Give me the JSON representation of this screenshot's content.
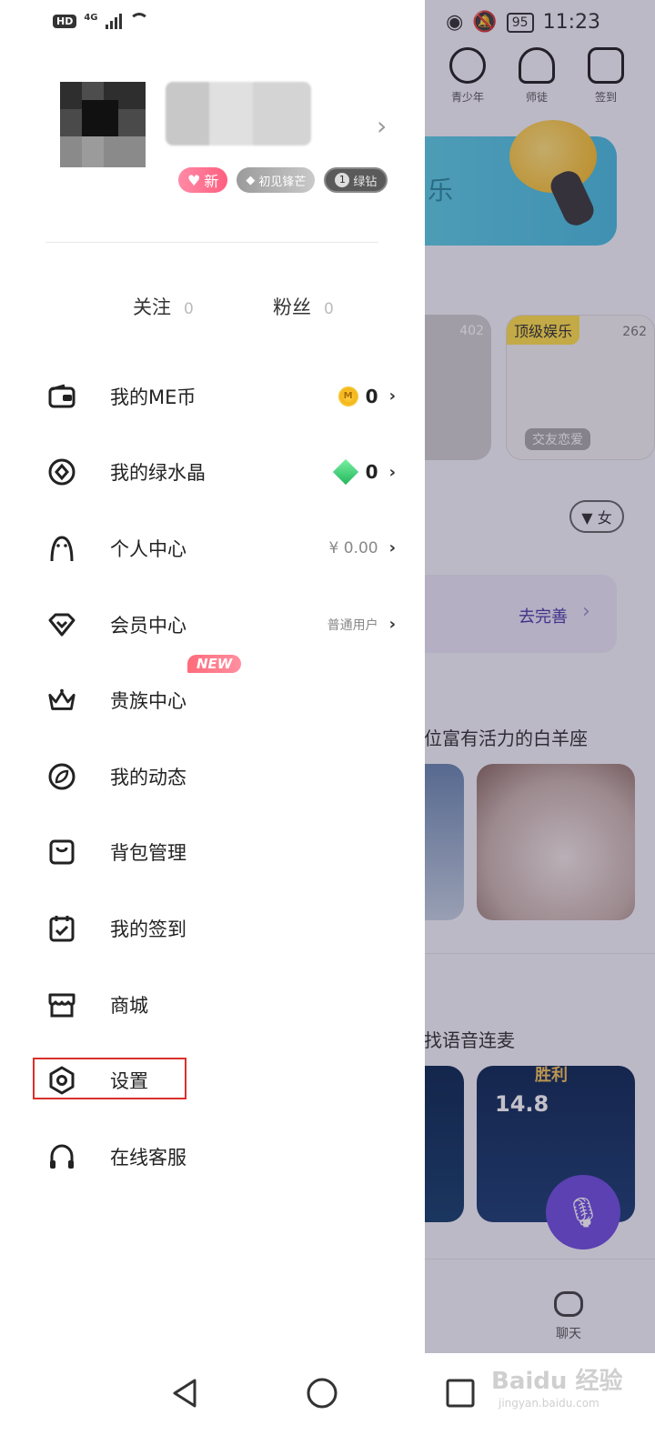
{
  "background": {
    "status_time": "11:23",
    "battery": "95",
    "top_icons": [
      {
        "label": "青少年",
        "icon": "teen-icon"
      },
      {
        "label": "师徒",
        "icon": "mentor-icon"
      },
      {
        "label": "签到",
        "icon": "checkin-icon"
      }
    ],
    "banner_text": "乐",
    "cards": [
      {
        "count": "402"
      },
      {
        "tag": "顶级娱乐",
        "count": "262",
        "subtitle": "交友恋爱"
      }
    ],
    "filter_label": "▼ 女",
    "complete_label": "去完善",
    "section_1": "位富有活力的白羊座",
    "section_2": "找语音连麦",
    "game_score": "14.8",
    "game_win": "胜利",
    "chat_label": "聊天"
  },
  "status_bar": {
    "hd": "HD",
    "network": "4G"
  },
  "profile": {
    "badges": [
      {
        "label": "新",
        "type": "new"
      },
      {
        "label": "初见锋芒",
        "type": "rank"
      },
      {
        "label": "绿钻",
        "level": "1",
        "type": "green"
      }
    ]
  },
  "follow": {
    "following_label": "关注",
    "following_count": "0",
    "fans_label": "粉丝",
    "fans_count": "0"
  },
  "menu": [
    {
      "label": "我的ME币",
      "icon": "wallet-icon",
      "value": "0"
    },
    {
      "label": "我的绿水晶",
      "icon": "crystal-icon",
      "value": "0"
    },
    {
      "label": "个人中心",
      "icon": "person-icon",
      "value": "¥ 0.00"
    },
    {
      "label": "会员中心",
      "icon": "diamond-icon",
      "value": "普通用户"
    },
    {
      "label": "贵族中心",
      "icon": "crown-icon",
      "tag": "NEW"
    },
    {
      "label": "我的动态",
      "icon": "leaf-icon"
    },
    {
      "label": "背包管理",
      "icon": "bag-icon"
    },
    {
      "label": "我的签到",
      "icon": "calendar-check-icon"
    },
    {
      "label": "商城",
      "icon": "store-icon"
    },
    {
      "label": "设置",
      "icon": "settings-hex-icon"
    },
    {
      "label": "在线客服",
      "icon": "headset-icon"
    }
  ],
  "watermark": {
    "logo": "Baidu 经验",
    "url": "jingyan.baidu.com"
  },
  "colors": {
    "highlight": "#d9312b",
    "accent_purple": "#6f4fe0",
    "new_tag": "#ff6b7a"
  }
}
